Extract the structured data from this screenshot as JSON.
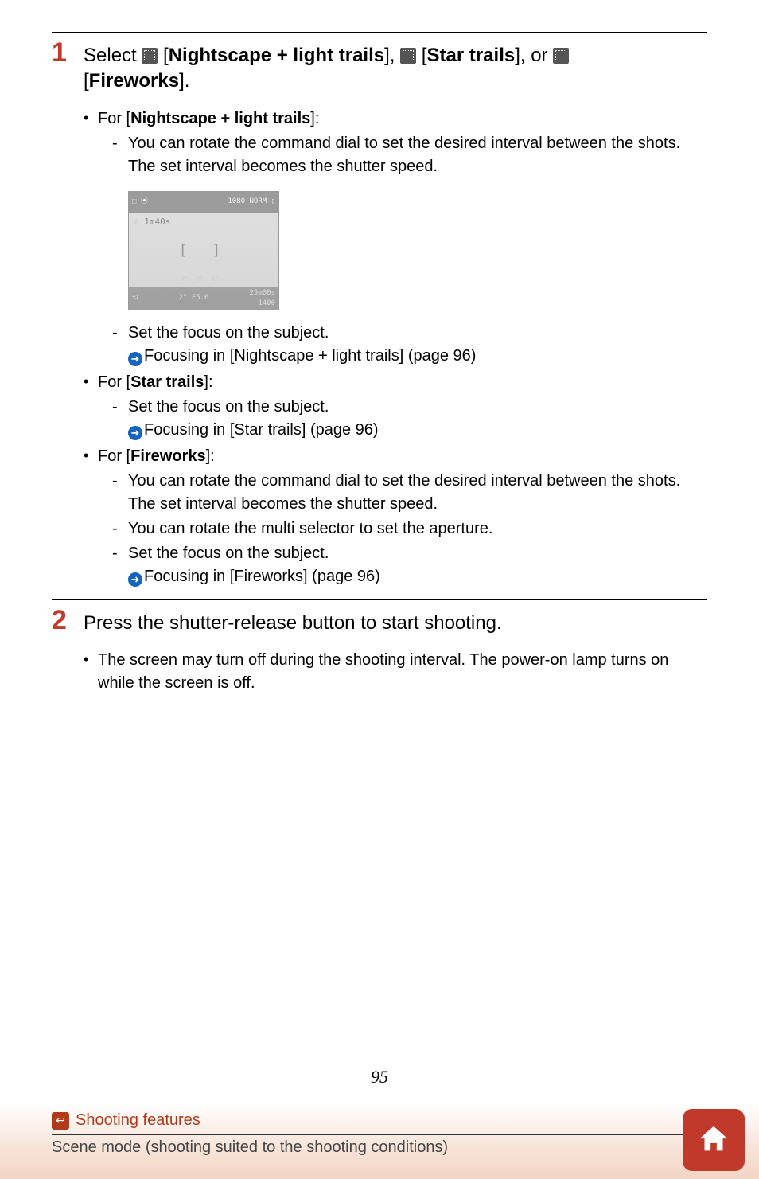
{
  "step1": {
    "title_lead": "Select ",
    "title_opt1": "Nightscape + light trails",
    "title_mid1": "], ",
    "title_opt2": "Star trails",
    "title_mid2": "], or ",
    "title_opt3": "Fireworks",
    "title_tail": "].",
    "for_nltrails_label": "For [",
    "nltrails_name": "Nightscape + light trails",
    "nltrails_bullet1": "You can rotate the command dial to set the desired interval between the shots. The set interval becomes the shutter speed.",
    "nltrails_bullet2": "Set the focus on the subject.",
    "nltrails_xref": "Focusing in [Nightscape + light trails] (page 96)",
    "for_star_label": "For [",
    "star_name": "Star trails",
    "star_bullet1": "Set the focus on the subject.",
    "star_xref": "Focusing in [Star trails] (page 96)",
    "for_fw_label": "For [",
    "fw_name": "Fireworks",
    "fw_bullet1": "You can rotate the command dial to set the desired interval between the shots. The set interval becomes the shutter speed.",
    "fw_bullet2": "You can rotate the multi selector to set the aperture.",
    "fw_bullet3": "Set the focus on the subject.",
    "fw_xref": "Focusing in [Fireworks] (page 96)"
  },
  "screen": {
    "top_left": "⬚ ⦿",
    "top_right": "1080 NORM ▯",
    "row2": "☄ 1m40s",
    "brackets": "[ ]",
    "scale_items": [
      "4\"",
      "2\"",
      "1\""
    ],
    "bottom_left": "⟲",
    "bottom_mid": "2\"   F5.6",
    "bottom_right_top": "25m00s",
    "bottom_right_bot": "1400"
  },
  "step2": {
    "title": "Press the shutter-release button to start shooting.",
    "bullet1": "The screen may turn off during the shooting interval. The power-on lamp turns on while the screen is off."
  },
  "page_number": "95",
  "footer": {
    "section": "Shooting features",
    "breadcrumb": "Scene mode (shooting suited to the shooting conditions)"
  }
}
